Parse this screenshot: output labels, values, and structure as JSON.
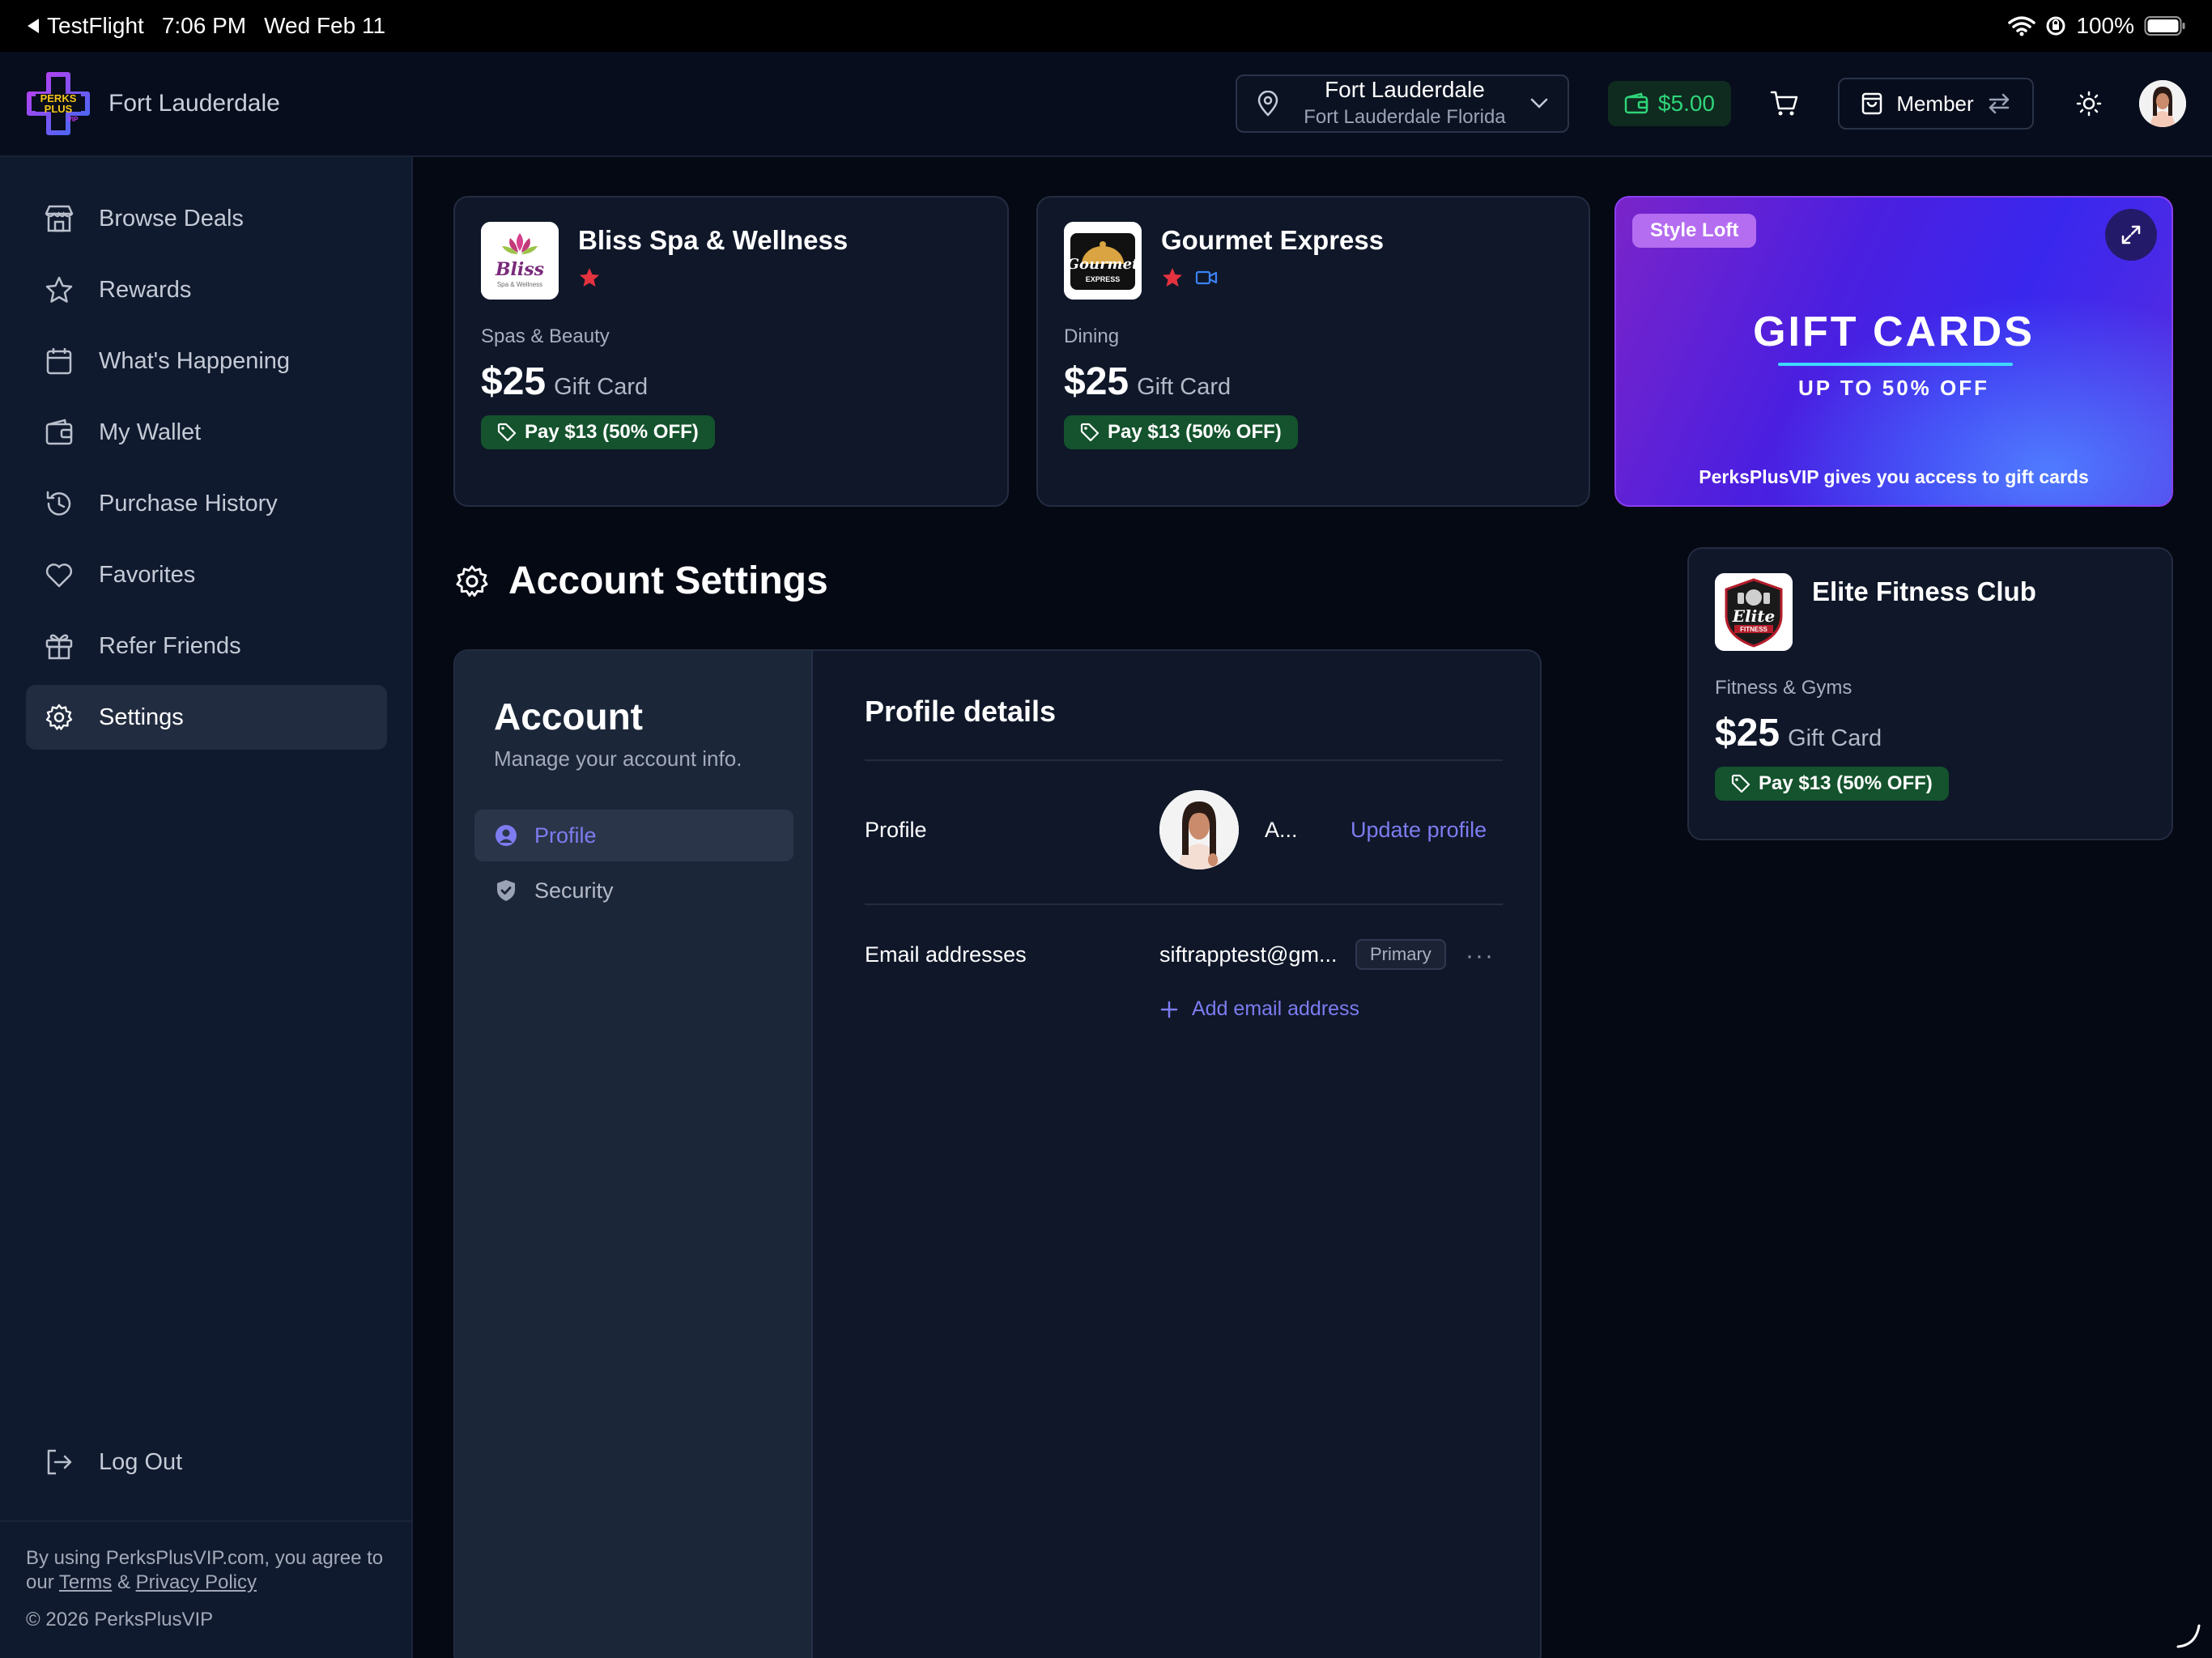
{
  "status_bar": {
    "back_app": "TestFlight",
    "time": "7:06 PM",
    "date": "Wed Feb 11",
    "battery": "100%"
  },
  "header": {
    "logo_text": "PERKS PLUS VIP",
    "city_title": "Fort Lauderdale",
    "location": {
      "city": "Fort Lauderdale",
      "state": "Fort Lauderdale Florida"
    },
    "wallet_balance": "$5.00",
    "member_label": "Member"
  },
  "sidebar": {
    "items": [
      {
        "label": "Browse Deals",
        "icon": "store-icon"
      },
      {
        "label": "Rewards",
        "icon": "star-icon"
      },
      {
        "label": "What's Happening",
        "icon": "calendar-icon"
      },
      {
        "label": "My Wallet",
        "icon": "wallet-icon"
      },
      {
        "label": "Purchase History",
        "icon": "history-icon"
      },
      {
        "label": "Favorites",
        "icon": "heart-icon"
      },
      {
        "label": "Refer Friends",
        "icon": "gift-icon"
      },
      {
        "label": "Settings",
        "icon": "gear-icon",
        "active": true
      }
    ],
    "logout_label": "Log Out",
    "footer": {
      "text_before": "By using PerksPlusVIP.com, you agree to our",
      "terms": "Terms",
      "amp": "&",
      "privacy": "Privacy Policy",
      "copyright": "© 2026 PerksPlusVIP"
    }
  },
  "deals": [
    {
      "name": "Bliss Spa & Wellness",
      "logo_text": "Bliss",
      "logo_sub": "Spa & Wellness",
      "category": "Spas & Beauty",
      "amount": "$25",
      "unit": "Gift Card",
      "badge": "Pay $13 (50% OFF)"
    },
    {
      "name": "Gourmet Express",
      "logo_text": "Gourmet",
      "logo_sub": "EXPRESS",
      "category": "Dining",
      "amount": "$25",
      "unit": "Gift Card",
      "badge": "Pay $13 (50% OFF)"
    },
    {
      "name": "Elite Fitness Club",
      "logo_text": "Elite",
      "logo_sub": "FITNESS",
      "category": "Fitness & Gyms",
      "amount": "$25",
      "unit": "Gift Card",
      "badge": "Pay $13 (50% OFF)"
    }
  ],
  "banner": {
    "tag": "Style Loft",
    "title": "GIFT CARDS",
    "subtitle": "UP TO 50% OFF",
    "footer": "PerksPlusVIP gives you access to gift cards"
  },
  "account_settings": {
    "heading": "Account Settings",
    "panel_title": "Account",
    "panel_subtitle": "Manage your account info.",
    "tabs": [
      {
        "label": "Profile",
        "active": true
      },
      {
        "label": "Security"
      }
    ],
    "profile_details_title": "Profile details",
    "profile_label": "Profile",
    "profile_name": "A...",
    "update_profile": "Update profile",
    "email_label": "Email addresses",
    "email_value": "siftrapptest@gm...",
    "primary_badge": "Primary",
    "more": "···",
    "add_email": "Add email address"
  },
  "colors": {
    "accent": "#7d7cf0",
    "badge_green": "#14532d",
    "wallet_green": "#2fd47a",
    "favorite_red": "#e5323f"
  }
}
